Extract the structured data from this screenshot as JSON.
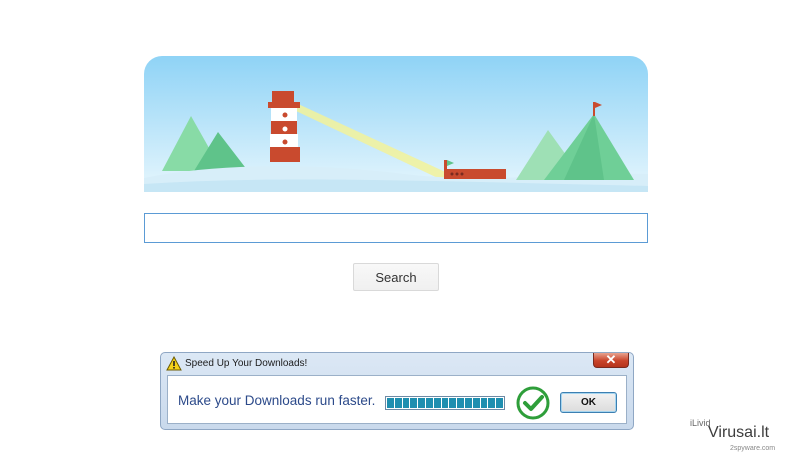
{
  "search": {
    "value": "",
    "placeholder": "",
    "button_label": "Search"
  },
  "popup": {
    "title": "Speed Up Your Downloads!",
    "close_label": "✕",
    "message": "Make your Downloads run faster.",
    "progress_percent": 100,
    "progress_segments": 15,
    "ok_label": "OK",
    "accent_color": "#1f8fb0",
    "check_color": "#2e9e3a"
  },
  "watermark": {
    "small": "iLivid",
    "main": "Virusai.lt",
    "sub": "2spyware.com"
  },
  "colors": {
    "sky_top": "#8fd3f6",
    "sky_bottom": "#d4eefb",
    "hills": "#6fcf97"
  }
}
